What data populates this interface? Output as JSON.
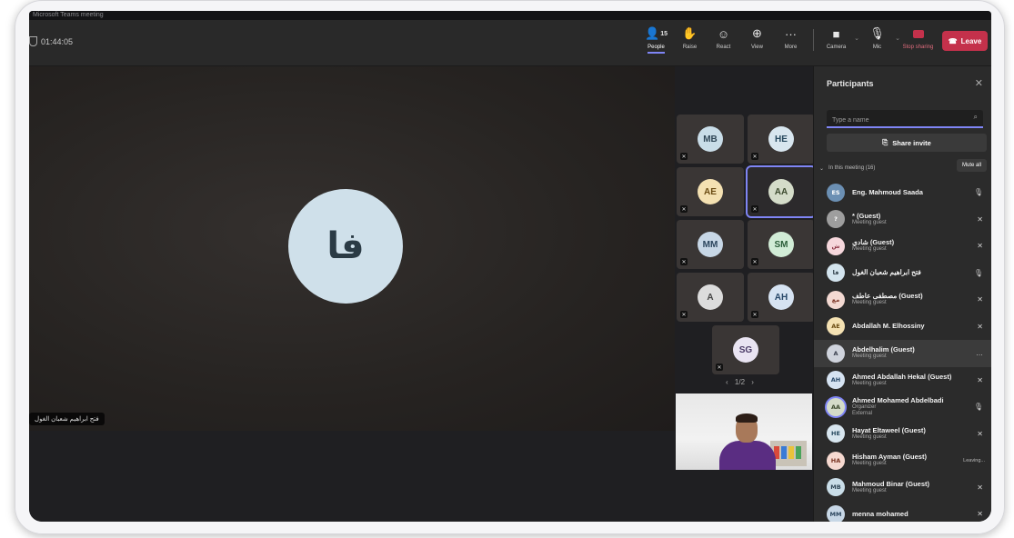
{
  "window": {
    "title": "Microsoft Teams meeting"
  },
  "meeting": {
    "elapsed": "01:44:05"
  },
  "toolbar": {
    "people_label": "People",
    "people_count": "15",
    "raise_label": "Raise",
    "react_label": "React",
    "view_label": "View",
    "more_label": "More",
    "camera_label": "Camera",
    "mic_label": "Mic",
    "share_label": "Stop sharing",
    "leave_label": "Leave"
  },
  "stage": {
    "speaker_initials": "فا",
    "speaker_name": "فتح ابراهيم شعبان الغول"
  },
  "gallery": {
    "tiles": [
      {
        "initials": "MB",
        "bg": "#c9dde8",
        "fg": "#2f4656"
      },
      {
        "initials": "HE",
        "bg": "#d8e6ef",
        "fg": "#26485e"
      },
      {
        "initials": "AE",
        "bg": "#f4e1b2",
        "fg": "#6a4b12"
      },
      {
        "initials": "AA",
        "bg": "#d4dcc9",
        "fg": "#3c4a2e"
      },
      {
        "initials": "MM",
        "bg": "#c7d7e6",
        "fg": "#2b455d"
      },
      {
        "initials": "SM",
        "bg": "#d1ecd6",
        "fg": "#2a5d38"
      },
      {
        "initials": "A",
        "bg": "#dcdcdc",
        "fg": "#444444"
      },
      {
        "initials": "AH",
        "bg": "#d6e3f2",
        "fg": "#274768"
      },
      {
        "initials": "SG",
        "bg": "#e9e4f2",
        "fg": "#4a3b66"
      }
    ],
    "pager": "1/2"
  },
  "panel": {
    "title": "Participants",
    "search_placeholder": "Type a name",
    "share_invite": "Share invite",
    "section_label": "In this meeting (16)",
    "mute_all": "Mute all",
    "participants": [
      {
        "name": "Eng. Mahmoud Saada",
        "sub": "",
        "initials": "ES",
        "bg": "#6b8fb3",
        "fg": "#ffffff",
        "status": "🎙"
      },
      {
        "name": "* (Guest)",
        "sub": "Meeting guest",
        "initials": "?",
        "bg": "#9e9e9e",
        "fg": "#ffffff",
        "status": "✕"
      },
      {
        "name": "شادي (Guest)",
        "sub": "Meeting guest",
        "initials": "ش",
        "bg": "#f6d7dc",
        "fg": "#8a2f40",
        "status": "✕"
      },
      {
        "name": "فتح ابراهيم شعبان الغول",
        "sub": "",
        "initials": "فا",
        "bg": "#d3e4ee",
        "fg": "#2b3b45",
        "status": "🎙"
      },
      {
        "name": "مصطفى عاطف (Guest)",
        "sub": "Meeting guest",
        "initials": "مع",
        "bg": "#f3d9d2",
        "fg": "#7c3526",
        "status": "✕"
      },
      {
        "name": "Abdallah M. Elhossiny",
        "sub": "",
        "initials": "AE",
        "bg": "#f4e1b2",
        "fg": "#6a4b12",
        "status": "✕"
      },
      {
        "name": "Abdelhalim (Guest)",
        "sub": "Meeting guest",
        "initials": "A",
        "bg": "#cfd3dc",
        "fg": "#3c4250",
        "status": "…"
      },
      {
        "name": "Ahmed Abdallah Hekal (Guest)",
        "sub": "Meeting guest",
        "initials": "AH",
        "bg": "#d6e3f2",
        "fg": "#274768",
        "status": "✕"
      },
      {
        "name": "Ahmed Mohamed Abdelbadi",
        "sub": "Organizer",
        "sub2": "External",
        "initials": "AA",
        "bg": "#d4dcc9",
        "fg": "#3c4a2e",
        "status": "🎙"
      },
      {
        "name": "Hayat Eltaweel (Guest)",
        "sub": "Meeting guest",
        "initials": "HE",
        "bg": "#d8e6ef",
        "fg": "#26485e",
        "status": "✕"
      },
      {
        "name": "Hisham Ayman (Guest)",
        "sub": "Meeting guest",
        "initials": "HA",
        "bg": "#f6d9d0",
        "fg": "#7a3422",
        "status": "Leaving..."
      },
      {
        "name": "Mahmoud Binar (Guest)",
        "sub": "Meeting guest",
        "initials": "MB",
        "bg": "#c9dde8",
        "fg": "#2f4656",
        "status": "✕"
      },
      {
        "name": "menna mohamed",
        "sub": "",
        "initials": "MM",
        "bg": "#c7d7e6",
        "fg": "#2b455d",
        "status": "✕"
      }
    ]
  },
  "colors": {
    "accent": "#7f85f5",
    "leave": "#c4314b"
  }
}
